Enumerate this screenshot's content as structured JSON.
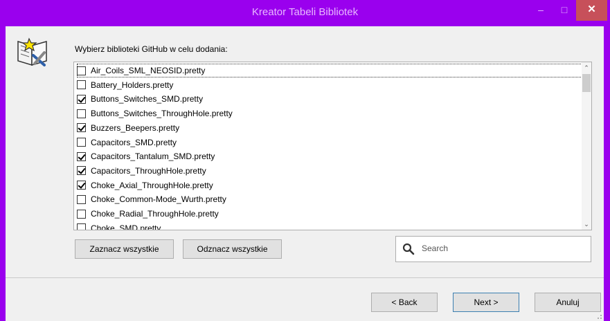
{
  "window": {
    "title": "Kreator Tabeli Bibliotek",
    "minimize_glyph": "–",
    "maximize_glyph": "□",
    "close_glyph": "✕"
  },
  "prompt": "Wybierz biblioteki GitHub w celu dodania:",
  "libraries": [
    {
      "label": "Air_Coils_SML_NEOSID.pretty",
      "checked": false
    },
    {
      "label": "Battery_Holders.pretty",
      "checked": false
    },
    {
      "label": "Buttons_Switches_SMD.pretty",
      "checked": true
    },
    {
      "label": "Buttons_Switches_ThroughHole.pretty",
      "checked": false
    },
    {
      "label": "Buzzers_Beepers.pretty",
      "checked": true
    },
    {
      "label": "Capacitors_SMD.pretty",
      "checked": false
    },
    {
      "label": "Capacitors_Tantalum_SMD.pretty",
      "checked": true
    },
    {
      "label": "Capacitors_ThroughHole.pretty",
      "checked": true
    },
    {
      "label": "Choke_Axial_ThroughHole.pretty",
      "checked": true
    },
    {
      "label": "Choke_Common-Mode_Wurth.pretty",
      "checked": false
    },
    {
      "label": "Choke_Radial_ThroughHole.pretty",
      "checked": false
    },
    {
      "label": "Choke_SMD.pretty",
      "checked": false
    }
  ],
  "buttons": {
    "select_all": "Zaznacz wszystkie",
    "deselect_all": "Odznacz wszystkie",
    "back": "< Back",
    "next": "Next >",
    "cancel": "Anuluj"
  },
  "search": {
    "placeholder": "Search"
  },
  "colors": {
    "titlebar": "#9a00ee",
    "close_button": "#c7505a",
    "dialog_bg": "#f0f0f0"
  },
  "icons": [
    "wizard-icon",
    "search-icon",
    "chevron-up-icon",
    "chevron-down-icon"
  ]
}
